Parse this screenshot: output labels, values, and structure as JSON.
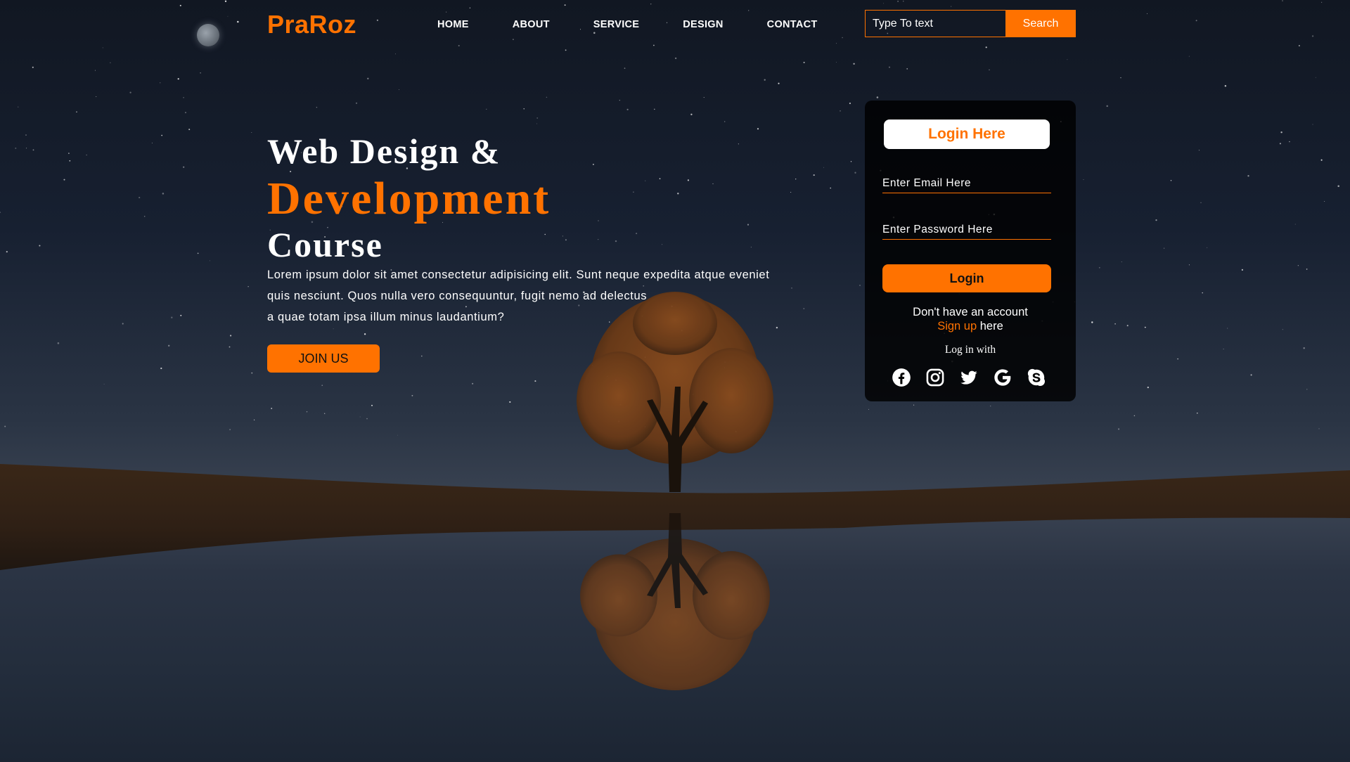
{
  "brand": {
    "logo": "PraRoz",
    "accent_color": "#ff7200"
  },
  "nav": {
    "items": [
      {
        "label": "HOME"
      },
      {
        "label": "ABOUT"
      },
      {
        "label": "SERVICE"
      },
      {
        "label": "DESIGN"
      },
      {
        "label": "CONTACT"
      }
    ]
  },
  "search": {
    "placeholder": "Type To text",
    "button_label": "Search"
  },
  "hero": {
    "line1": "Web Design &",
    "line2": "Development",
    "line3": "Course",
    "paragraph_line1": "Lorem ipsum dolor sit amet consectetur adipisicing elit. Sunt neque expedita atque eveniet",
    "paragraph_line2": "quis nesciunt. Quos nulla vero consequuntur, fugit nemo ad delectus",
    "paragraph_line3": "a quae totam ipsa illum minus laudantium?",
    "cta_label": "JOIN US"
  },
  "login": {
    "title": "Login Here",
    "email_placeholder": "Enter Email Here",
    "password_placeholder": "Enter Password Here",
    "button_label": "Login",
    "no_account_text": "Don't have an account",
    "signup_link": "Sign up",
    "signup_suffix": " here",
    "login_with_text": "Log in with",
    "social_icons": [
      "facebook-icon",
      "instagram-icon",
      "twitter-icon",
      "google-icon",
      "skype-icon"
    ]
  }
}
